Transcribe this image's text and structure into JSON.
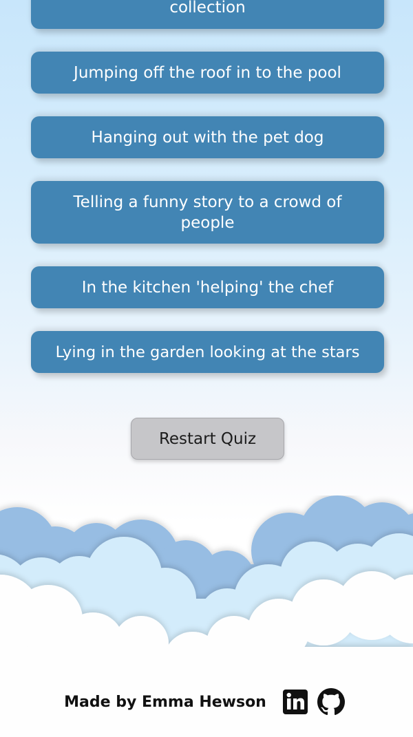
{
  "quiz": {
    "answers": [
      {
        "label": "collection"
      },
      {
        "label": "Jumping off the roof in to the pool"
      },
      {
        "label": "Hanging out with the pet dog"
      },
      {
        "label": "Telling a funny story to a crowd of people"
      },
      {
        "label": "In the kitchen 'helping' the chef"
      },
      {
        "label": "Lying in the garden looking at the stars"
      }
    ],
    "restart_label": "Restart Quiz"
  },
  "footer": {
    "credit": "Made by Emma Hewson",
    "links": [
      {
        "icon": "linkedin-icon"
      },
      {
        "icon": "github-icon"
      }
    ]
  },
  "colors": {
    "answer_button": "#4285b4",
    "restart_button": "#c6c6c9",
    "sky_top": "#c8e6fb",
    "cloud_dark": "#97bde3",
    "cloud_mid": "#d3ecfb",
    "cloud_light": "#fefefe"
  }
}
